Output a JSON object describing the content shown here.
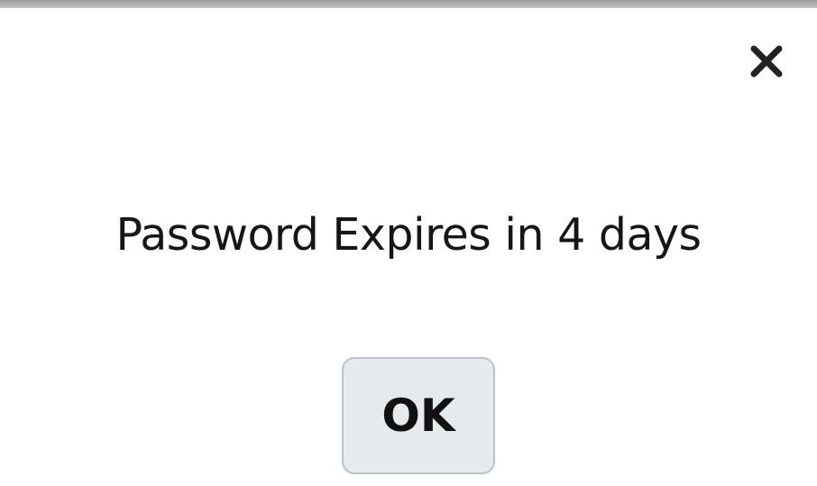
{
  "dialog": {
    "message": "Password Expires in 4 days",
    "ok_label": "OK",
    "close_icon": "close-icon"
  }
}
